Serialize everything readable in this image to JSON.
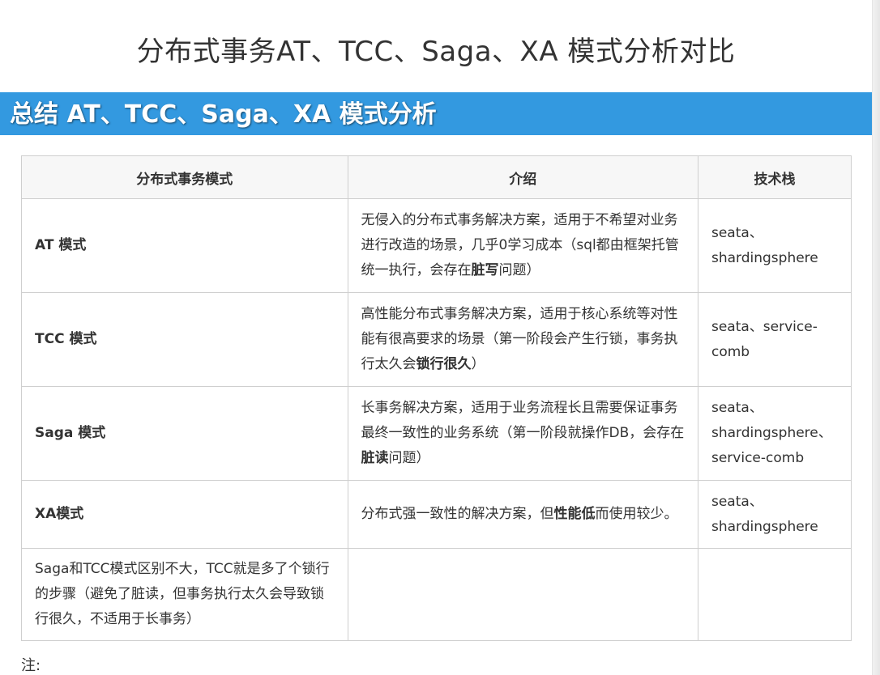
{
  "page_title": "分布式事务AT、TCC、Saga、XA 模式分析对比",
  "section_heading": "总结 AT、TCC、Saga、XA 模式分析",
  "table": {
    "headers": [
      "分布式事务模式",
      "介绍",
      "技术栈"
    ],
    "rows": [
      {
        "mode": "AT 模式",
        "intro_before": "无侵入的分布式事务解决方案，适用于不希望对业务进行改造的场景，几乎0学习成本（sql都由框架托管统一执行，会存在",
        "intro_bold": "脏写",
        "intro_after": "问题）",
        "stack": "seata、shardingsphere"
      },
      {
        "mode": "TCC 模式",
        "intro_before": "高性能分布式事务解决方案，适用于核心系统等对性能有很高要求的场景（第一阶段会产生行锁，事务执行太久会",
        "intro_bold": "锁行很久",
        "intro_after": "）",
        "stack": "seata、service-comb"
      },
      {
        "mode": "Saga 模式",
        "intro_before": "长事务解决方案，适用于业务流程长且需要保证事务最终一致性的业务系统（第一阶段就操作DB，会存在",
        "intro_bold": "脏读",
        "intro_after": "问题）",
        "stack": "seata、shardingsphere、service-comb"
      },
      {
        "mode": "XA模式",
        "intro_before": "分布式强一致性的解决方案，但",
        "intro_bold": "性能低",
        "intro_after": "而使用较少。",
        "stack": "seata、shardingsphere"
      }
    ],
    "note_row": "Saga和TCC模式区别不大，TCC就是多了个锁行的步骤（避免了脏读，但事务执行太久会导致锁行很久，不适用于长事务）"
  },
  "note_label": "注:"
}
